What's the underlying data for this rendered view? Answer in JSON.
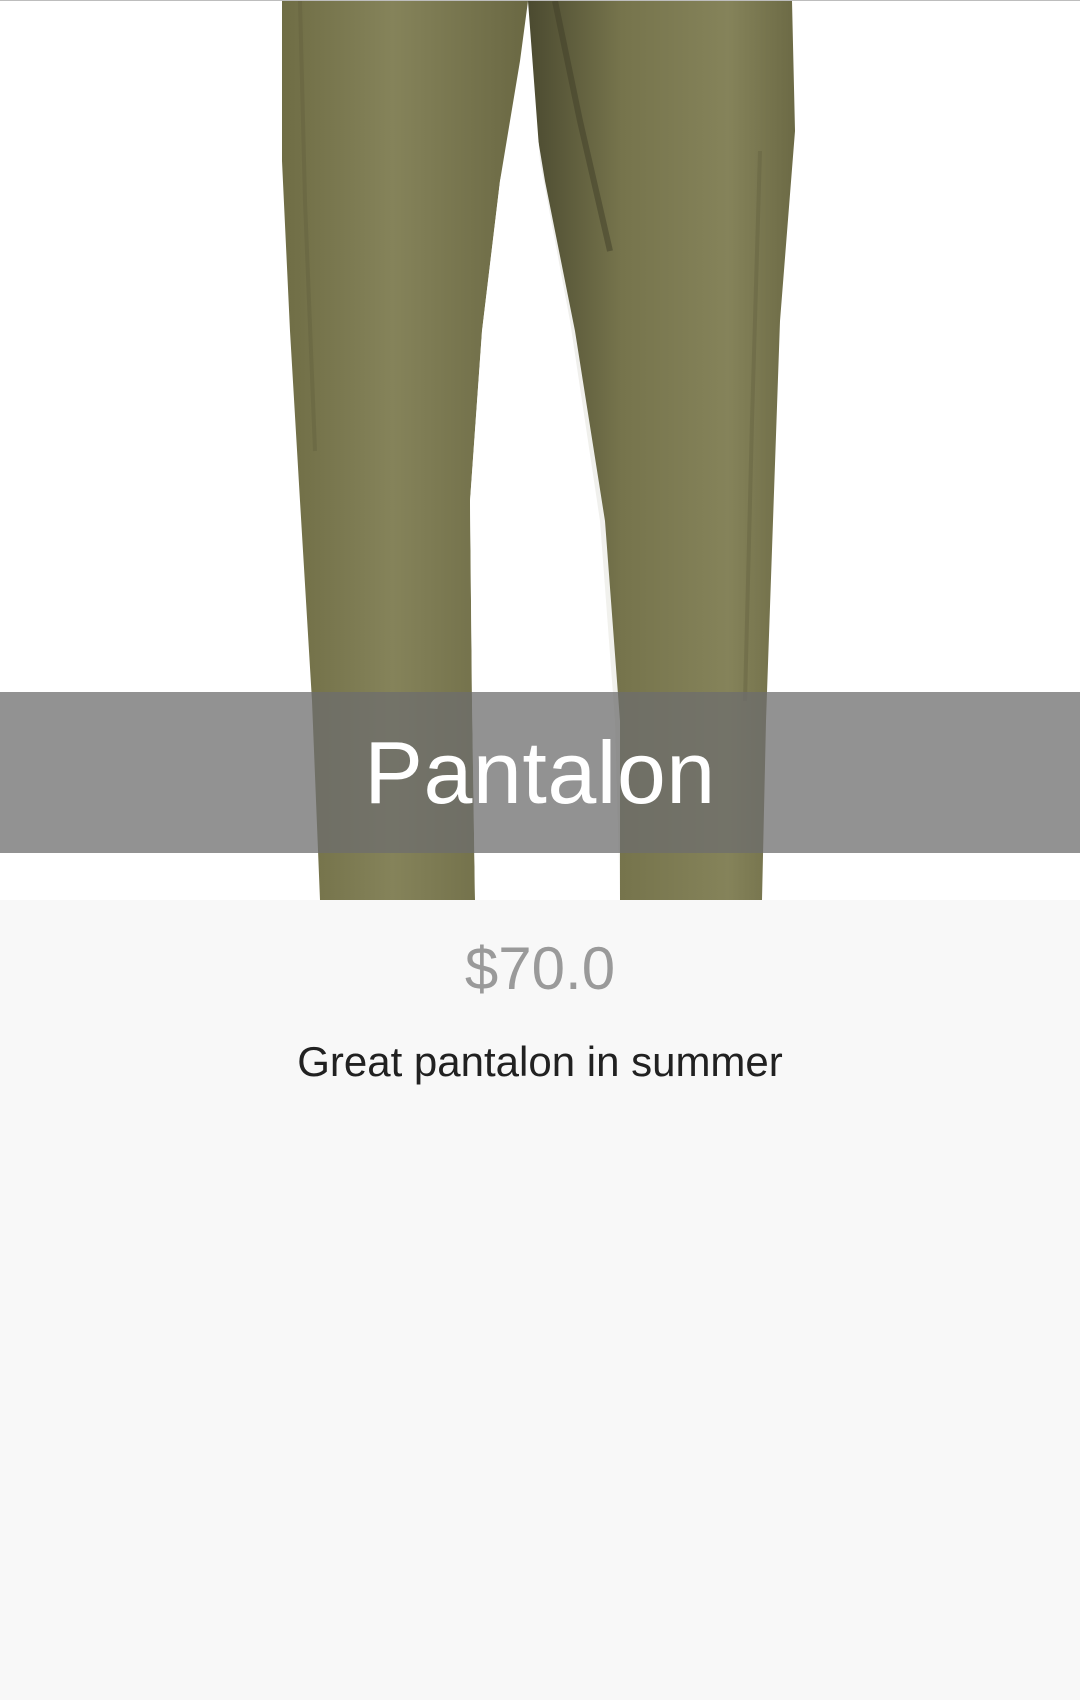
{
  "product": {
    "image_icon": "pants-photo",
    "title": "Pantalon",
    "price": "$70.0",
    "description": "Great pantalon in summer"
  },
  "colors": {
    "background": "#f8f8f8",
    "image_background": "#ffffff",
    "pants": "#7c7a4f",
    "title_band": "#6e6e6e",
    "price": "#9a9a9a",
    "description": "#212121"
  }
}
